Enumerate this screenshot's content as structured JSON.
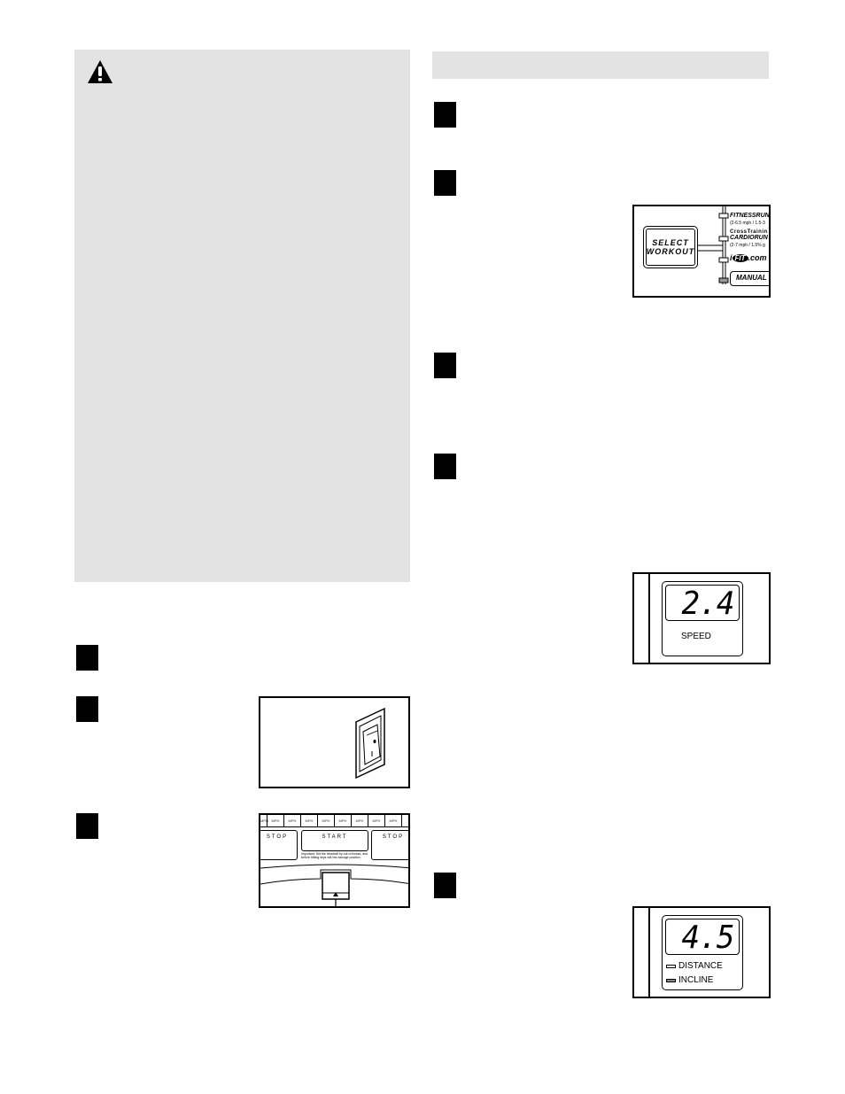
{
  "left_column": {
    "warning_panel": {
      "icon": "warning-triangle-icon",
      "background": "#e3e3e3"
    },
    "steps": [
      {
        "number": ""
      },
      {
        "number": ""
      },
      {
        "number": ""
      }
    ]
  },
  "right_column": {
    "section_header": {
      "background": "#e3e3e3"
    },
    "steps": [
      {
        "number": ""
      },
      {
        "number": ""
      },
      {
        "number": ""
      },
      {
        "number": ""
      },
      {
        "number": ""
      }
    ]
  },
  "figures": {
    "select_workout": {
      "button_line1": "SELECT",
      "button_line2": "WORKOUT",
      "options": [
        {
          "title": "FITNESSRUN",
          "subtitle": "(2-6.5 mph / 1.5-3"
        },
        {
          "title_top": "CrossTrainin",
          "title": "CARDIORUN",
          "subtitle": "(2-7 mph / 1.5% g"
        },
        {
          "title": "iFIT.com",
          "logo_text": "FIT"
        },
        {
          "title": "MANUAL"
        }
      ]
    },
    "console": {
      "mph_label": "MPH",
      "mph_cell_count": 9,
      "stop_left": "STOP",
      "start": "START",
      "stop_right": "STOP",
      "note": "Important: Set the treadmill by out of thread, and before hitting keys will into storage position."
    },
    "speed_display": {
      "value": "2.4",
      "label": "SPEED"
    },
    "incline_display": {
      "value": "4.5",
      "indicators": [
        {
          "label": "DISTANCE",
          "active": false
        },
        {
          "label": "INCLINE",
          "active": true
        }
      ],
      "active_indicator_color": "#888888"
    }
  }
}
